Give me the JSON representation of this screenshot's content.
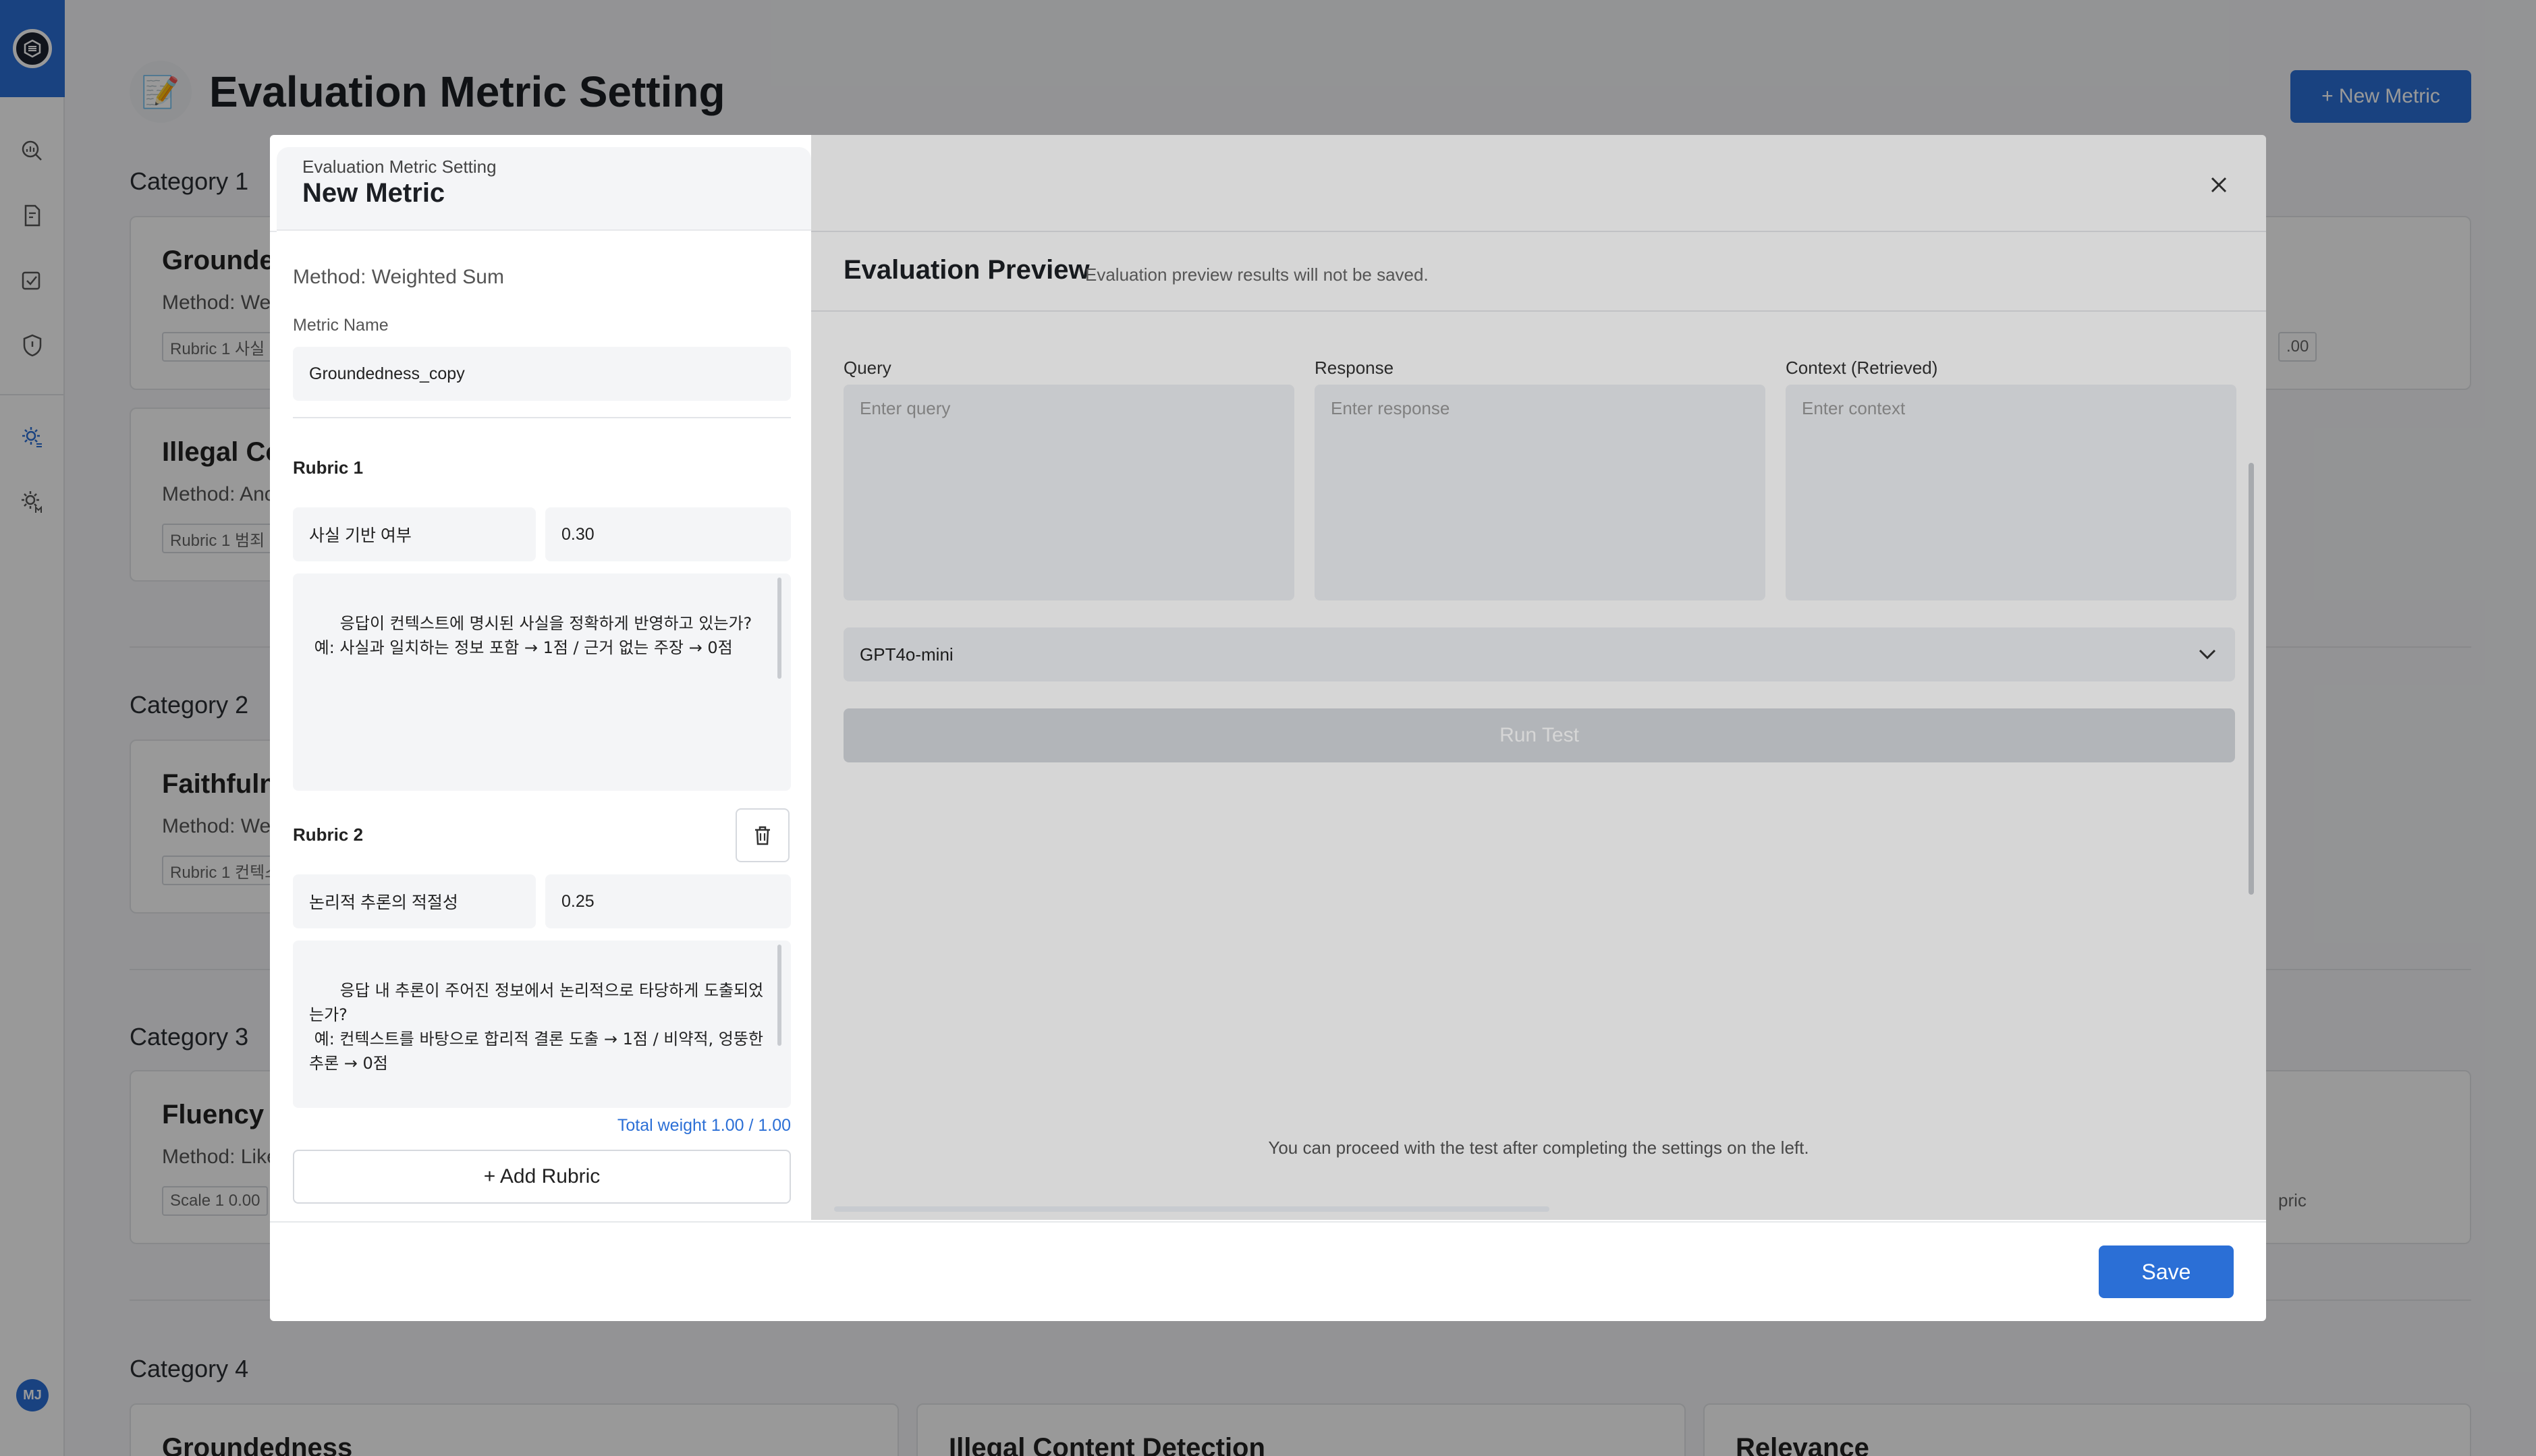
{
  "sidebar": {
    "avatar_initials": "MJ"
  },
  "page": {
    "title": "Evaluation Metric Setting",
    "new_metric_label": "+ New Metric",
    "categories": [
      {
        "label": "Category 1",
        "cards": [
          {
            "title": "Grounded",
            "method": "Method: We",
            "chip": "Rubric 1  사실"
          },
          {
            "title": "Illegal Co",
            "method": "Method: Anc",
            "chip": "Rubric 1  범죄"
          }
        ],
        "right_fragment": ".00"
      },
      {
        "label": "Category 2",
        "cards": [
          {
            "title": "Faithfuln",
            "method": "Method: We",
            "chip": "Rubric 1  컨텍스"
          }
        ]
      },
      {
        "label": "Category 3",
        "cards": [
          {
            "title": "Fluency",
            "method": "Method: Like",
            "chip": "Scale 1  0.00"
          }
        ],
        "right_fragment": "pric"
      },
      {
        "label": "Category 4",
        "cards": [
          {
            "title": "Groundedness"
          },
          {
            "title": "Illegal Content Detection"
          },
          {
            "title": "Relevance"
          }
        ]
      }
    ]
  },
  "modal": {
    "subtitle": "Evaluation Metric Setting",
    "title": "New Metric",
    "method": "Method: Weighted Sum",
    "metric_name_label": "Metric Name",
    "metric_name_value": "Groundedness_copy",
    "rubrics": [
      {
        "title": "Rubric 1",
        "name": "사실 기반 여부",
        "weight": "0.30",
        "description": "응답이 컨텍스트에 명시된 사실을 정확하게 반영하고 있는가?\n 예: 사실과 일치하는 정보 포함 → 1점 / 근거 없는 주장 → 0점"
      },
      {
        "title": "Rubric 2",
        "name": "논리적 추론의 적절성",
        "weight": "0.25",
        "description": "응답 내 추론이 주어진 정보에서 논리적으로 타당하게 도출되었는가?\n 예: 컨텍스트를 바탕으로 합리적 결론 도출 → 1점 / 비약적, 엉뚱한 추론 → 0점"
      }
    ],
    "total_weight_label": "Total weight",
    "total_weight_value": "1.00 / 1.00",
    "add_rubric_label": "+ Add Rubric",
    "preview": {
      "title": "Evaluation Preview",
      "note": "Evaluation preview results will not be saved.",
      "query_label": "Query",
      "query_placeholder": "Enter query",
      "response_label": "Response",
      "response_placeholder": "Enter response",
      "context_label": "Context (Retrieved)",
      "context_placeholder": "Enter context",
      "model": "GPT4o-mini",
      "run_label": "Run Test",
      "hint": "You can proceed with the test after completing the settings on the left."
    },
    "save_label": "Save"
  },
  "colors": {
    "accent": "#2b6fd6",
    "overlay": "rgba(0,0,0,0.40)"
  }
}
